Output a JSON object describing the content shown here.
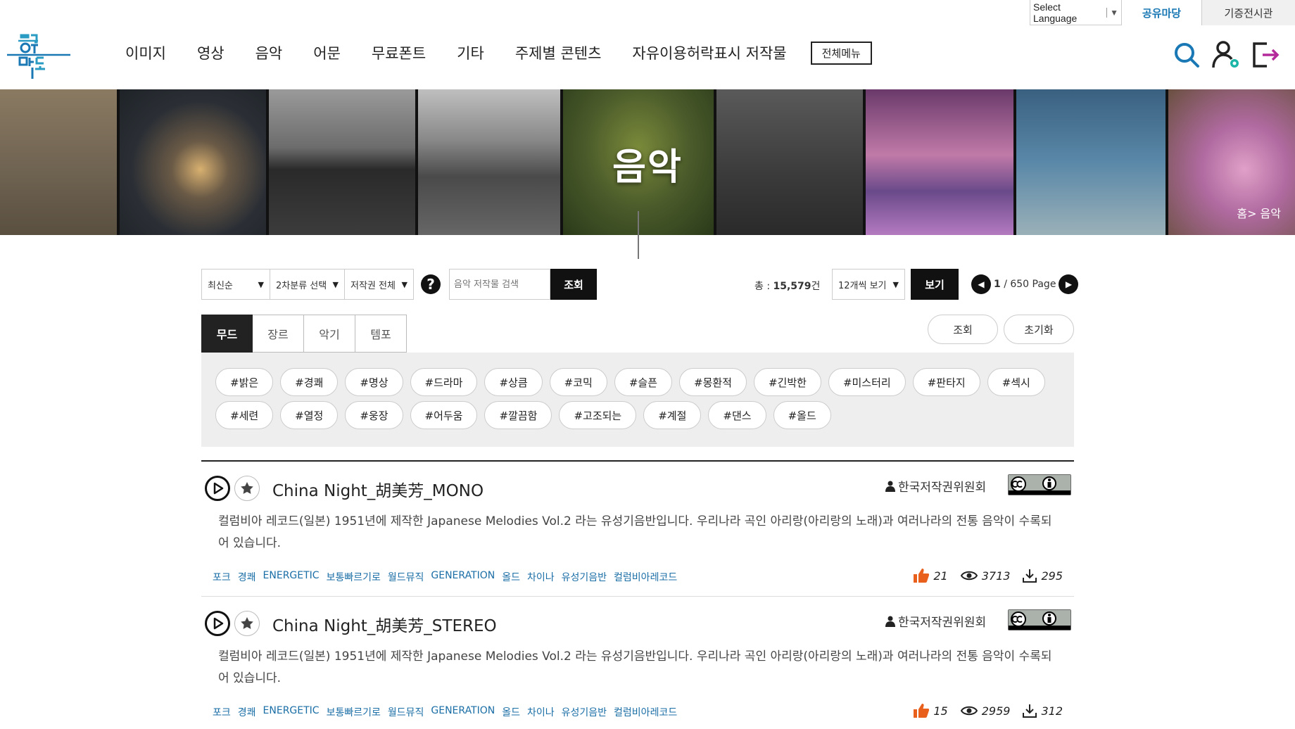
{
  "util": {
    "language_label": "Select Language",
    "language_arrow": "▼",
    "tab_share": "공유마당",
    "tab_donate": "기증전시관"
  },
  "logo": {
    "text": "공유마당"
  },
  "gnb": {
    "items": [
      "이미지",
      "영상",
      "음악",
      "어문",
      "무료폰트",
      "기타",
      "주제별 콘텐츠",
      "자유이용허락표시 저작물"
    ],
    "all_menu": "전체메뉴"
  },
  "icons": [
    "search-icon",
    "user-settings-icon",
    "logout-icon"
  ],
  "banner": {
    "title": "음악",
    "breadcrumb": "홈> 음악"
  },
  "filters": {
    "sort": "최신순",
    "category": "2차분류 선택",
    "license": "저작권 전체",
    "help": "?",
    "search_placeholder": "음악 저작물 검색",
    "search_button": "조회",
    "total_label": "총 : ",
    "total_value": "15,579",
    "total_unit": "건",
    "per_page": "12개씩 보기",
    "view_button": "보기",
    "page_current": "1",
    "page_rest": " / 650 Page"
  },
  "tabs": [
    "무드",
    "장르",
    "악기",
    "템포"
  ],
  "right_buttons": {
    "search": "조회",
    "reset": "초기화"
  },
  "tags": {
    "row1": [
      "#밝은",
      "#경쾌",
      "#명상",
      "#드라마",
      "#상큼",
      "#코믹",
      "#슬픈",
      "#몽환적",
      "#긴박한",
      "#미스터리",
      "#판타지",
      "#섹시"
    ],
    "row2": [
      "#세련",
      "#열정",
      "#웅장",
      "#어두움",
      "#깔끔함",
      "#고조되는",
      "#계절",
      "#댄스",
      "#올드"
    ]
  },
  "items": [
    {
      "title": "China Night_胡美芳_MONO",
      "owner": "한국저작권위원회",
      "desc": "컬럼비아 레코드(일본) 1951년에 제작한 Japanese Melodies Vol.2 라는 유성기음반입니다. 우리나라 곡인 아리랑(아리랑의 노래)과 여러나라의 전통 음악이 수록되어 있습니다.",
      "keywords": [
        "포크",
        "경쾌",
        "ENERGETIC",
        "보통빠르기로",
        "월드뮤직",
        "GENERATION",
        "올드",
        "차이나",
        "유성기음반",
        "컬럼비아레코드"
      ],
      "likes": "21",
      "views": "3713",
      "downloads": "295"
    },
    {
      "title": "China Night_胡美芳_STEREO",
      "owner": "한국저작권위원회",
      "desc": "컬럼비아 레코드(일본) 1951년에 제작한 Japanese Melodies Vol.2 라는 유성기음반입니다. 우리나라 곡인 아리랑(아리랑의 노래)과 여러나라의 전통 음악이 수록되어 있습니다.",
      "keywords": [
        "포크",
        "경쾌",
        "ENERGETIC",
        "보통빠르기로",
        "월드뮤직",
        "GENERATION",
        "올드",
        "차이나",
        "유성기음반",
        "컬럼비아레코드"
      ],
      "likes": "15",
      "views": "2959",
      "downloads": "312"
    }
  ],
  "colors": {
    "accent": "#1a78b4",
    "dark": "#111111",
    "keyword": "#1a6ea6",
    "like": "#e8601c"
  }
}
